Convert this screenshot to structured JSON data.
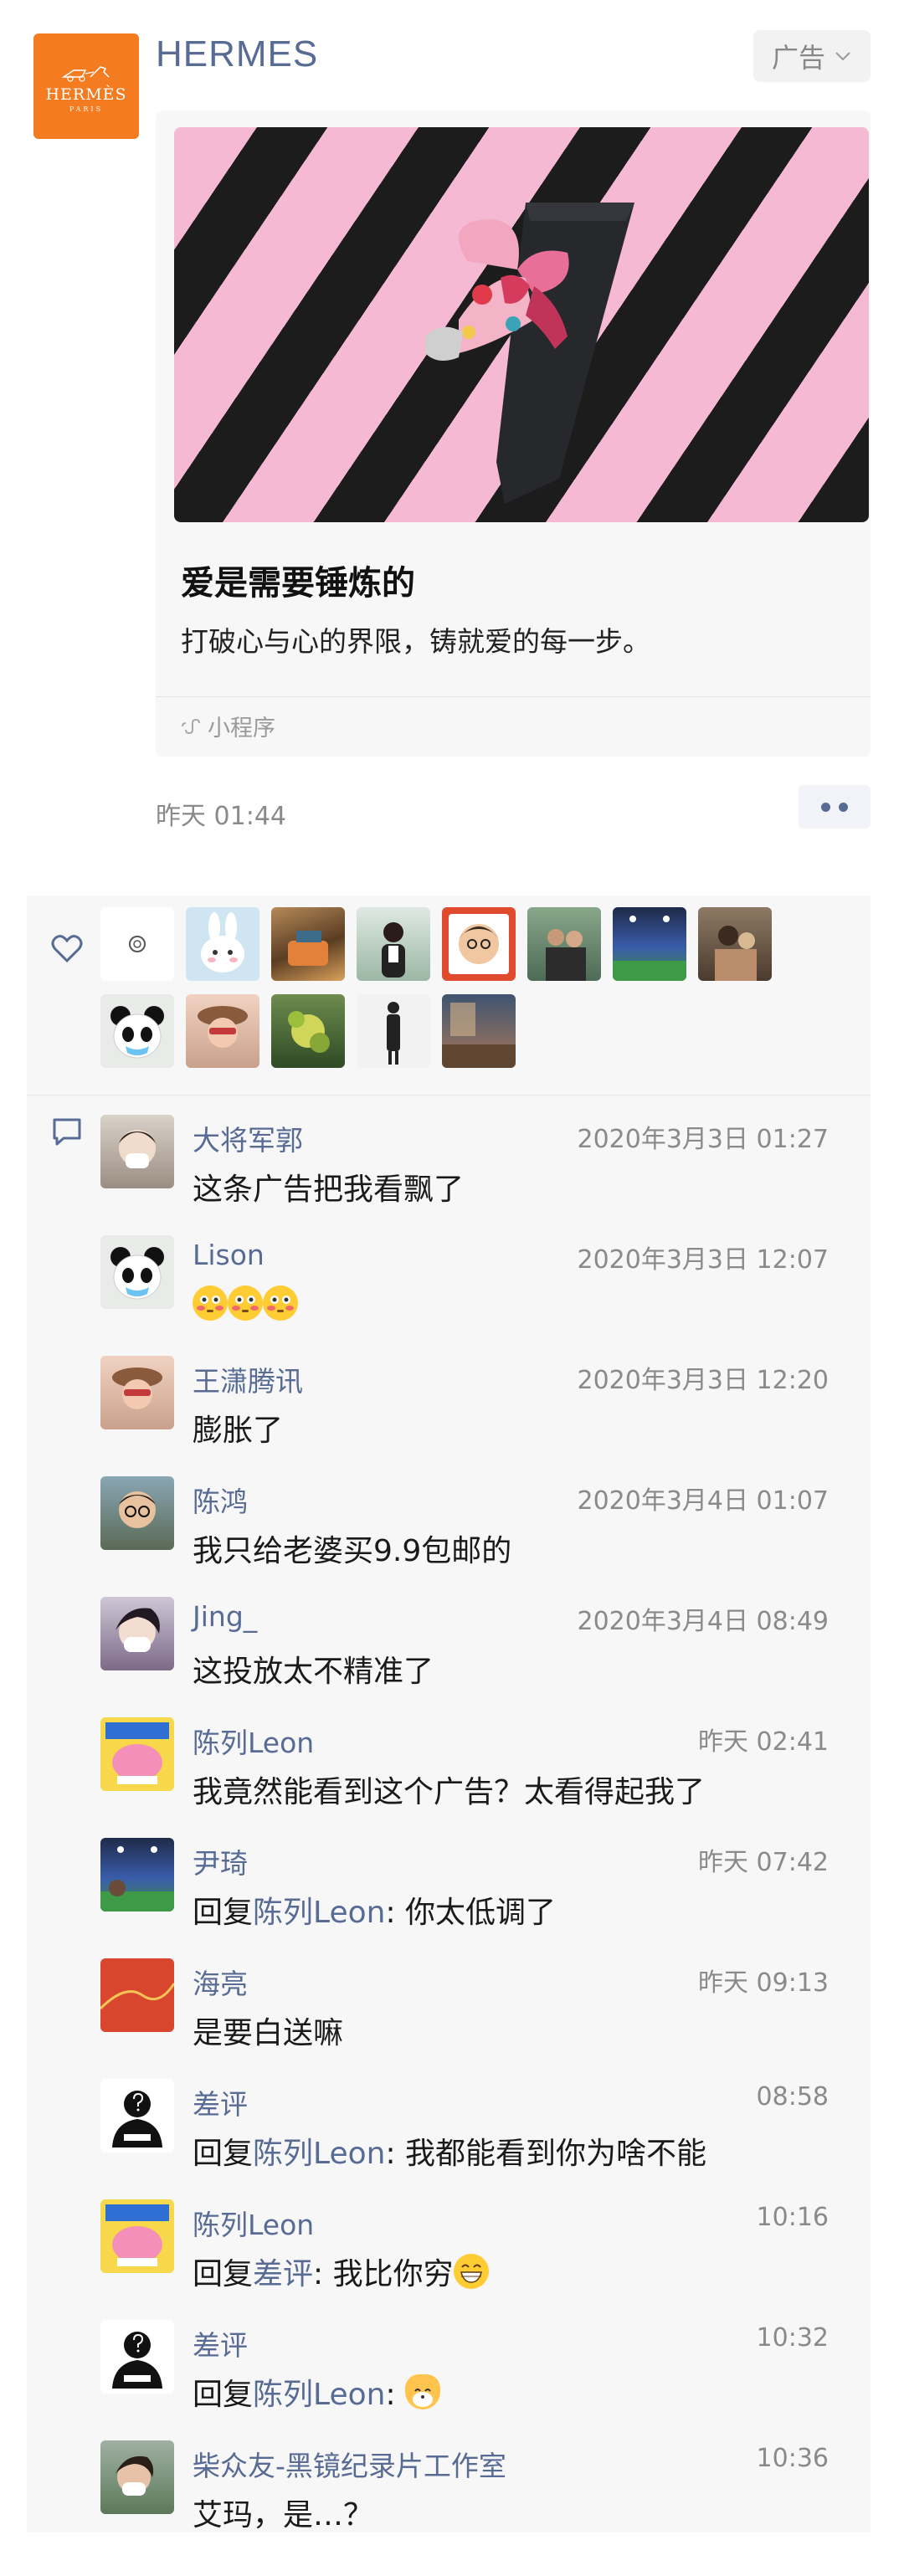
{
  "post": {
    "brand_logo_word": "HERMÈS",
    "brand_logo_sub": "PARIS",
    "poster_name": "HERMES",
    "ad_tag": "广告",
    "ad_title": "爱是需要锤炼的",
    "ad_description": "打破心与心的界限，铸就爱的每一步。",
    "mini_program": "小程序",
    "time": "昨天 01:44"
  },
  "colors": {
    "link": "#576b95",
    "brand_orange": "#f47b20",
    "stripe_pink": "#f6b9d3",
    "stripe_dark": "#1c1c1c"
  },
  "likers_count": 14,
  "comments": [
    {
      "name": "大将军郭",
      "time": "2020年3月3日 01:27",
      "text": "这条广告把我看飘了",
      "avatar": "masked-person"
    },
    {
      "name": "Lison",
      "time": "2020年3月3日 12:07",
      "text": "",
      "emojis": [
        "flushed-face",
        "flushed-face",
        "flushed-face"
      ],
      "avatar": "panda"
    },
    {
      "name": "王潇腾讯",
      "time": "2020年3月3日 12:20",
      "text": "膨胀了",
      "avatar": "woman-sunglasses"
    },
    {
      "name": "陈鸿",
      "time": "2020年3月4日 01:07",
      "text": "我只给老婆买9.9包邮的",
      "avatar": "man-glasses"
    },
    {
      "name": "Jing_",
      "time": "2020年3月4日 08:49",
      "text": "这投放太不精准了",
      "avatar": "masked-person"
    },
    {
      "name": "陈列Leon",
      "time": "昨天 02:41",
      "text": "我竟然能看到这个广告？太看得起我了",
      "avatar": "pink-sticker"
    },
    {
      "name": "尹琦",
      "time": "昨天 07:42",
      "reply_to": "陈列Leon",
      "text": ": 你太低调了",
      "avatar": "stadium"
    },
    {
      "name": "海亮",
      "time": "昨天 09:13",
      "text": "是要白送嘛",
      "avatar": "red-chart"
    },
    {
      "name": "差评",
      "time": "08:58",
      "reply_to": "陈列Leon",
      "text": ": 我都能看到你为啥不能",
      "avatar": "mystery-person"
    },
    {
      "name": "陈列Leon",
      "time": "10:16",
      "reply_to": "差评",
      "text": ": 我比你穷",
      "emojis": [
        "grinning-face"
      ],
      "avatar": "pink-sticker"
    },
    {
      "name": "差评",
      "time": "10:32",
      "reply_to": "陈列Leon",
      "text": ": ",
      "emojis": [
        "cat-face"
      ],
      "avatar": "mystery-person"
    },
    {
      "name": "柴众友-黑镜纪录片工作室",
      "time": "10:36",
      "text": "艾玛，是…？",
      "avatar": "masked-woman"
    }
  ]
}
